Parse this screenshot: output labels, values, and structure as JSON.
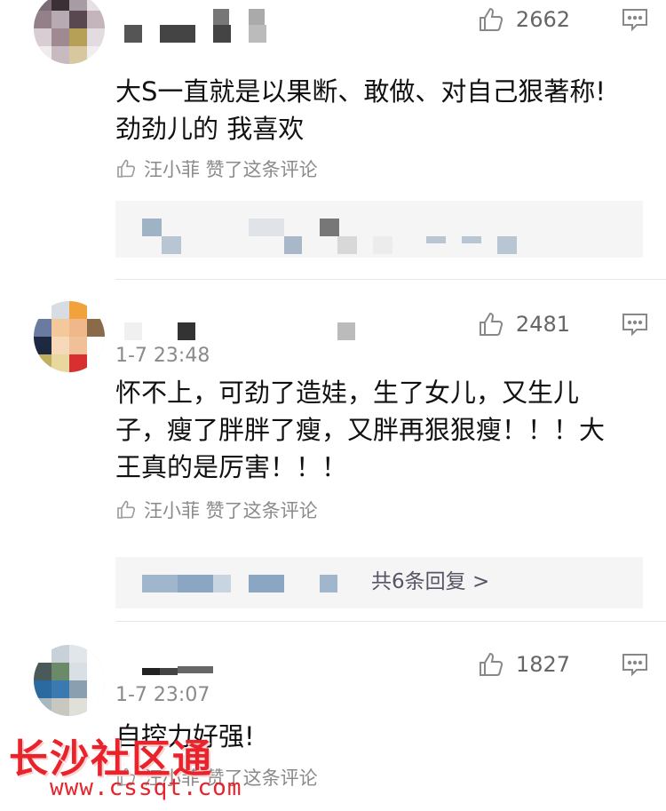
{
  "comments": [
    {
      "time": "",
      "likes": "2662",
      "text_lines": [
        "大S一直就是以果断、敢做、对自己狠著称!",
        "劲劲儿的 我喜欢"
      ],
      "liked_by": "汪小菲 赞了这条评论"
    },
    {
      "time": "1-7 23:48",
      "likes": "2481",
      "text_lines": [
        "怀不上，可劲了造娃，生了女儿，又生儿",
        "子，瘦了胖胖了瘦，又胖再狠狠瘦！！！大",
        "王真的是厉害！！！"
      ],
      "liked_by": "汪小菲 赞了这条评论",
      "reply_tail": "共6条回复 >"
    },
    {
      "time": "1-7 23:07",
      "likes": "1827",
      "text_lines": [
        "自控力好强!"
      ],
      "liked_by": "汪小菲 赞了这条评论"
    }
  ],
  "watermark": {
    "title": "长沙社区通",
    "url": "www.cssqt.com"
  },
  "colors": {
    "text": "#111111",
    "meta": "#8a8a8a",
    "watermark_red": "#e8232b",
    "reply_bg": "#f5f5f5"
  },
  "icons": [
    "thumbs-up-icon",
    "comment-reply-icon",
    "liked-thumb-icon"
  ]
}
